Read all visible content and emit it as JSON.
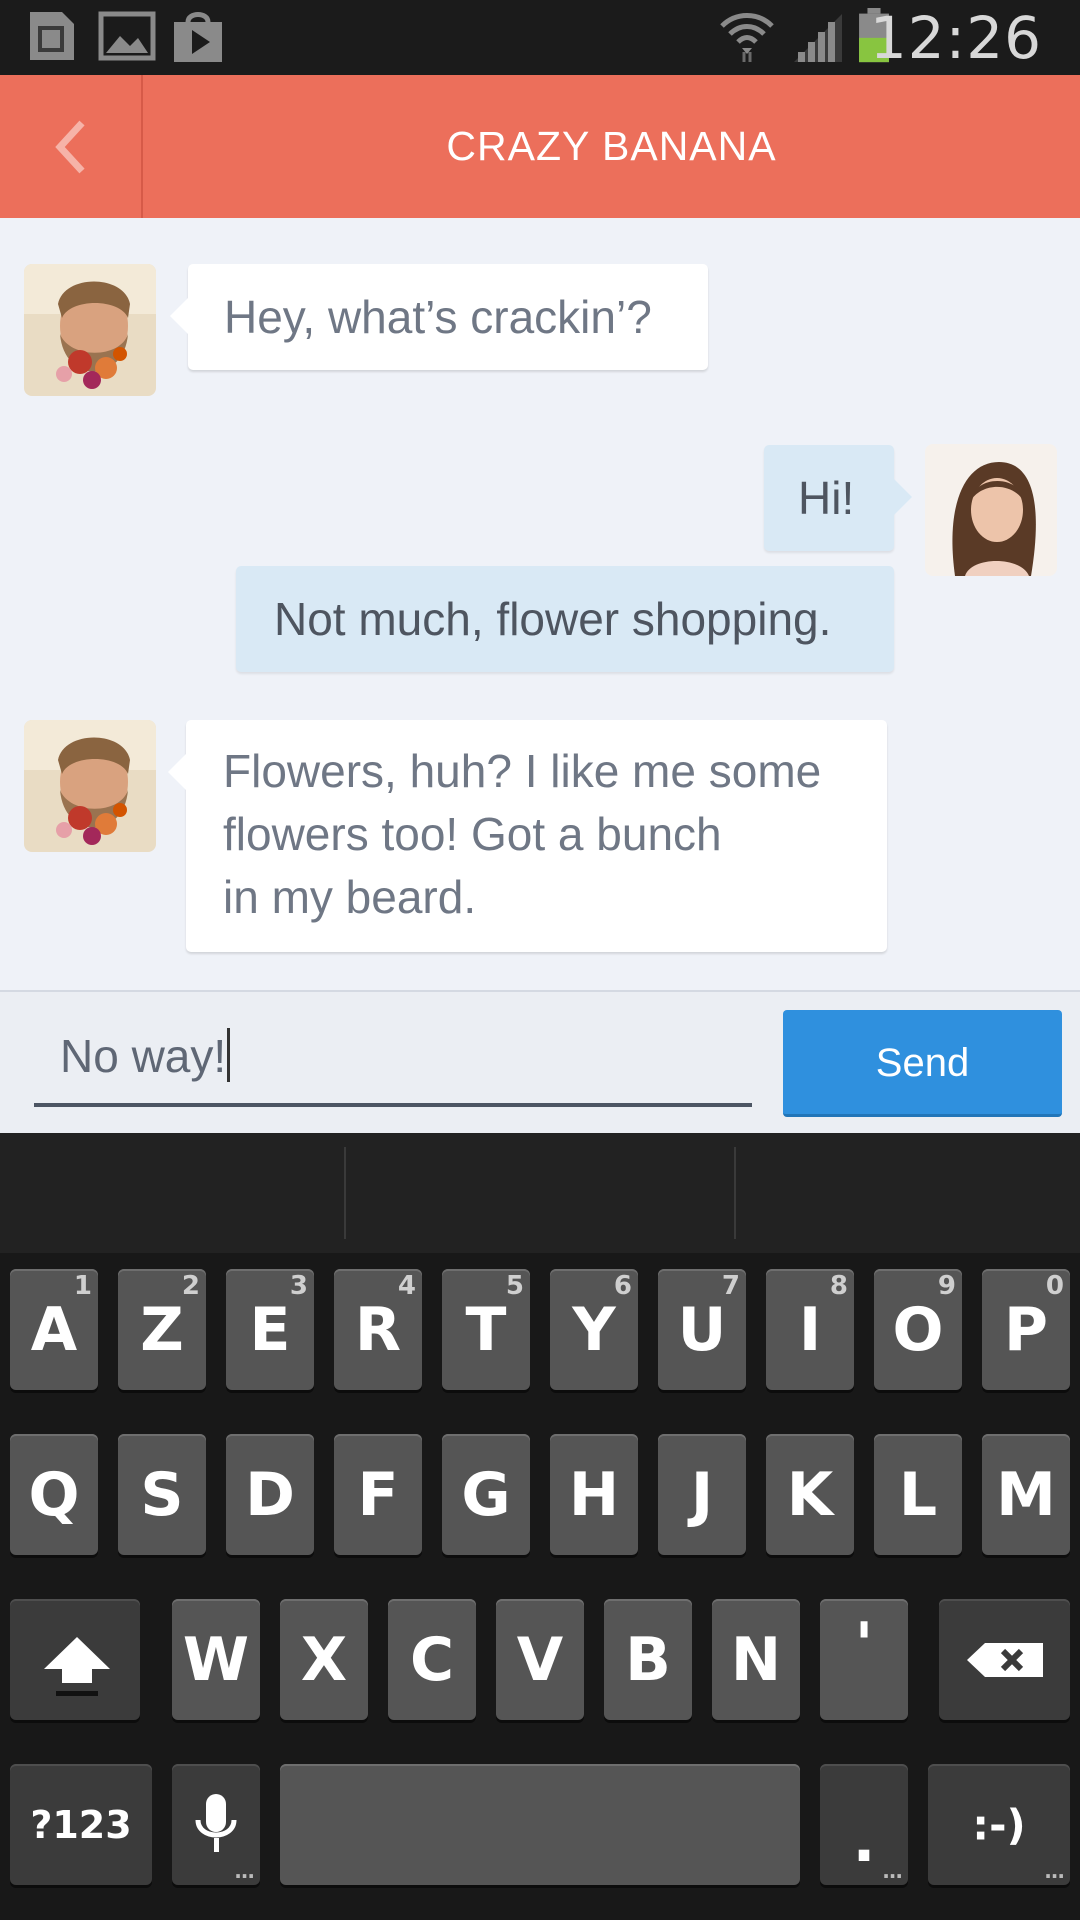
{
  "status_bar": {
    "time": "12:26",
    "left_icons": [
      "sim-card-icon",
      "image-notification-icon",
      "play-store-icon"
    ],
    "right_icons": [
      "wifi-icon",
      "signal-icon",
      "battery-icon"
    ],
    "battery_color": "#88c540"
  },
  "header": {
    "back_icon": "chevron-left-icon",
    "title": "CRAZY BANANA",
    "background": "#ec6f5b"
  },
  "messages": [
    {
      "sender": "contact",
      "text": "Hey, what’s crackin’?"
    },
    {
      "sender": "me",
      "text": "Hi!"
    },
    {
      "sender": "me",
      "text": "Not much, flower shopping."
    },
    {
      "sender": "contact",
      "lines": [
        "Flowers, huh? I like me some",
        "flowers too! Got a bunch",
        "in my beard."
      ]
    }
  ],
  "composer": {
    "input_value": "No way!",
    "send_label": "Send",
    "send_color": "#2f90de"
  },
  "keyboard": {
    "row1": [
      {
        "k": "A",
        "h": "1"
      },
      {
        "k": "Z",
        "h": "2"
      },
      {
        "k": "E",
        "h": "3"
      },
      {
        "k": "R",
        "h": "4"
      },
      {
        "k": "T",
        "h": "5"
      },
      {
        "k": "Y",
        "h": "6"
      },
      {
        "k": "U",
        "h": "7"
      },
      {
        "k": "I",
        "h": "8"
      },
      {
        "k": "O",
        "h": "9"
      },
      {
        "k": "P",
        "h": "0"
      }
    ],
    "row2": [
      "Q",
      "S",
      "D",
      "F",
      "G",
      "H",
      "J",
      "K",
      "L",
      "M"
    ],
    "row3": [
      "W",
      "X",
      "C",
      "V",
      "B",
      "N",
      "'"
    ],
    "shift_icon": "shift-arrow-icon",
    "backspace_icon": "backspace-icon",
    "symbols_label": "?123",
    "mic_icon": "microphone-icon",
    "period_label": ".",
    "smiley_label": ":-)"
  }
}
